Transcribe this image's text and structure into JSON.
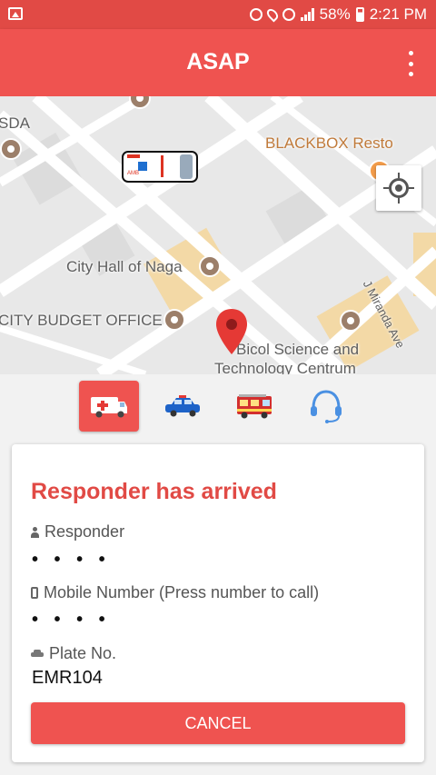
{
  "status_bar": {
    "battery": "58%",
    "time": "2:21 PM"
  },
  "app": {
    "title": "ASAP"
  },
  "map": {
    "labels": {
      "sda": "SDA",
      "blackbox": "BLACKBOX Resto",
      "city_hall": "City Hall of Naga",
      "budget_office": "CITY BUDGET OFFICE",
      "bicol_science_1": "Bicol Science and",
      "bicol_science_2": "Technology Centrum",
      "street": "J Miranda Ave"
    }
  },
  "service_tabs": [
    {
      "icon": "ambulance-icon",
      "active": true
    },
    {
      "icon": "police-car-icon",
      "active": false
    },
    {
      "icon": "fire-truck-icon",
      "active": false
    },
    {
      "icon": "headset-icon",
      "active": false
    }
  ],
  "card": {
    "status": "Responder has arrived",
    "responder_label": "Responder",
    "responder_value": "• • • •",
    "mobile_label": "Mobile Number (Press number to call)",
    "mobile_value": "• • • •",
    "plate_label": "Plate No.",
    "plate_value": "EMR104",
    "cancel_label": "CANCEL"
  },
  "colors": {
    "accent": "#ef5350",
    "status_bar": "#e14a45",
    "title_red": "#e14a45"
  }
}
